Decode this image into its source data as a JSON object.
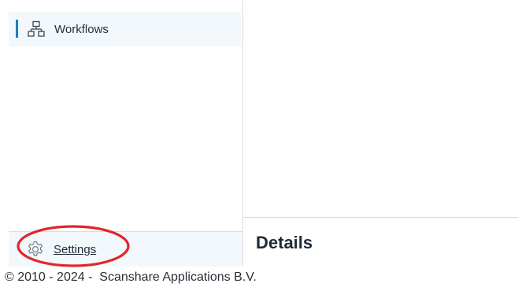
{
  "sidebar": {
    "nav": [
      {
        "label": "Workflows",
        "icon": "workflow-icon",
        "active": true
      }
    ],
    "settings": {
      "label": "Settings",
      "icon": "gear-icon"
    }
  },
  "details": {
    "title": "Details"
  },
  "footer": {
    "copyright": "© 2010 - 2024 -  Scanshare Applications B.V."
  },
  "colors": {
    "accent": "#1b7ec2",
    "sidebar_bg": "#f2f8fc",
    "divider": "#d8dde2",
    "annotation": "#e0262c"
  }
}
